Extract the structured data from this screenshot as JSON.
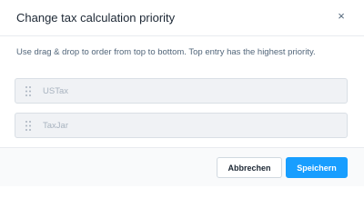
{
  "modal": {
    "title": "Change tax calculation priority",
    "close_icon": "close-icon",
    "close_glyph": "×"
  },
  "body": {
    "instructions": "Use drag & drop to order from top to bottom. Top entry has the highest priority.",
    "items": [
      {
        "label": "USTax",
        "icon": "drag-handle-icon"
      },
      {
        "label": "TaxJar",
        "icon": "drag-handle-icon"
      }
    ]
  },
  "footer": {
    "cancel_label": "Abbrechen",
    "save_label": "Speichern"
  },
  "colors": {
    "accent": "#189eff",
    "title_text": "#1c2734",
    "muted_text": "#52667a",
    "item_text": "#a8b3bf",
    "item_background": "#f0f2f5",
    "footer_background": "#f9fafb"
  }
}
